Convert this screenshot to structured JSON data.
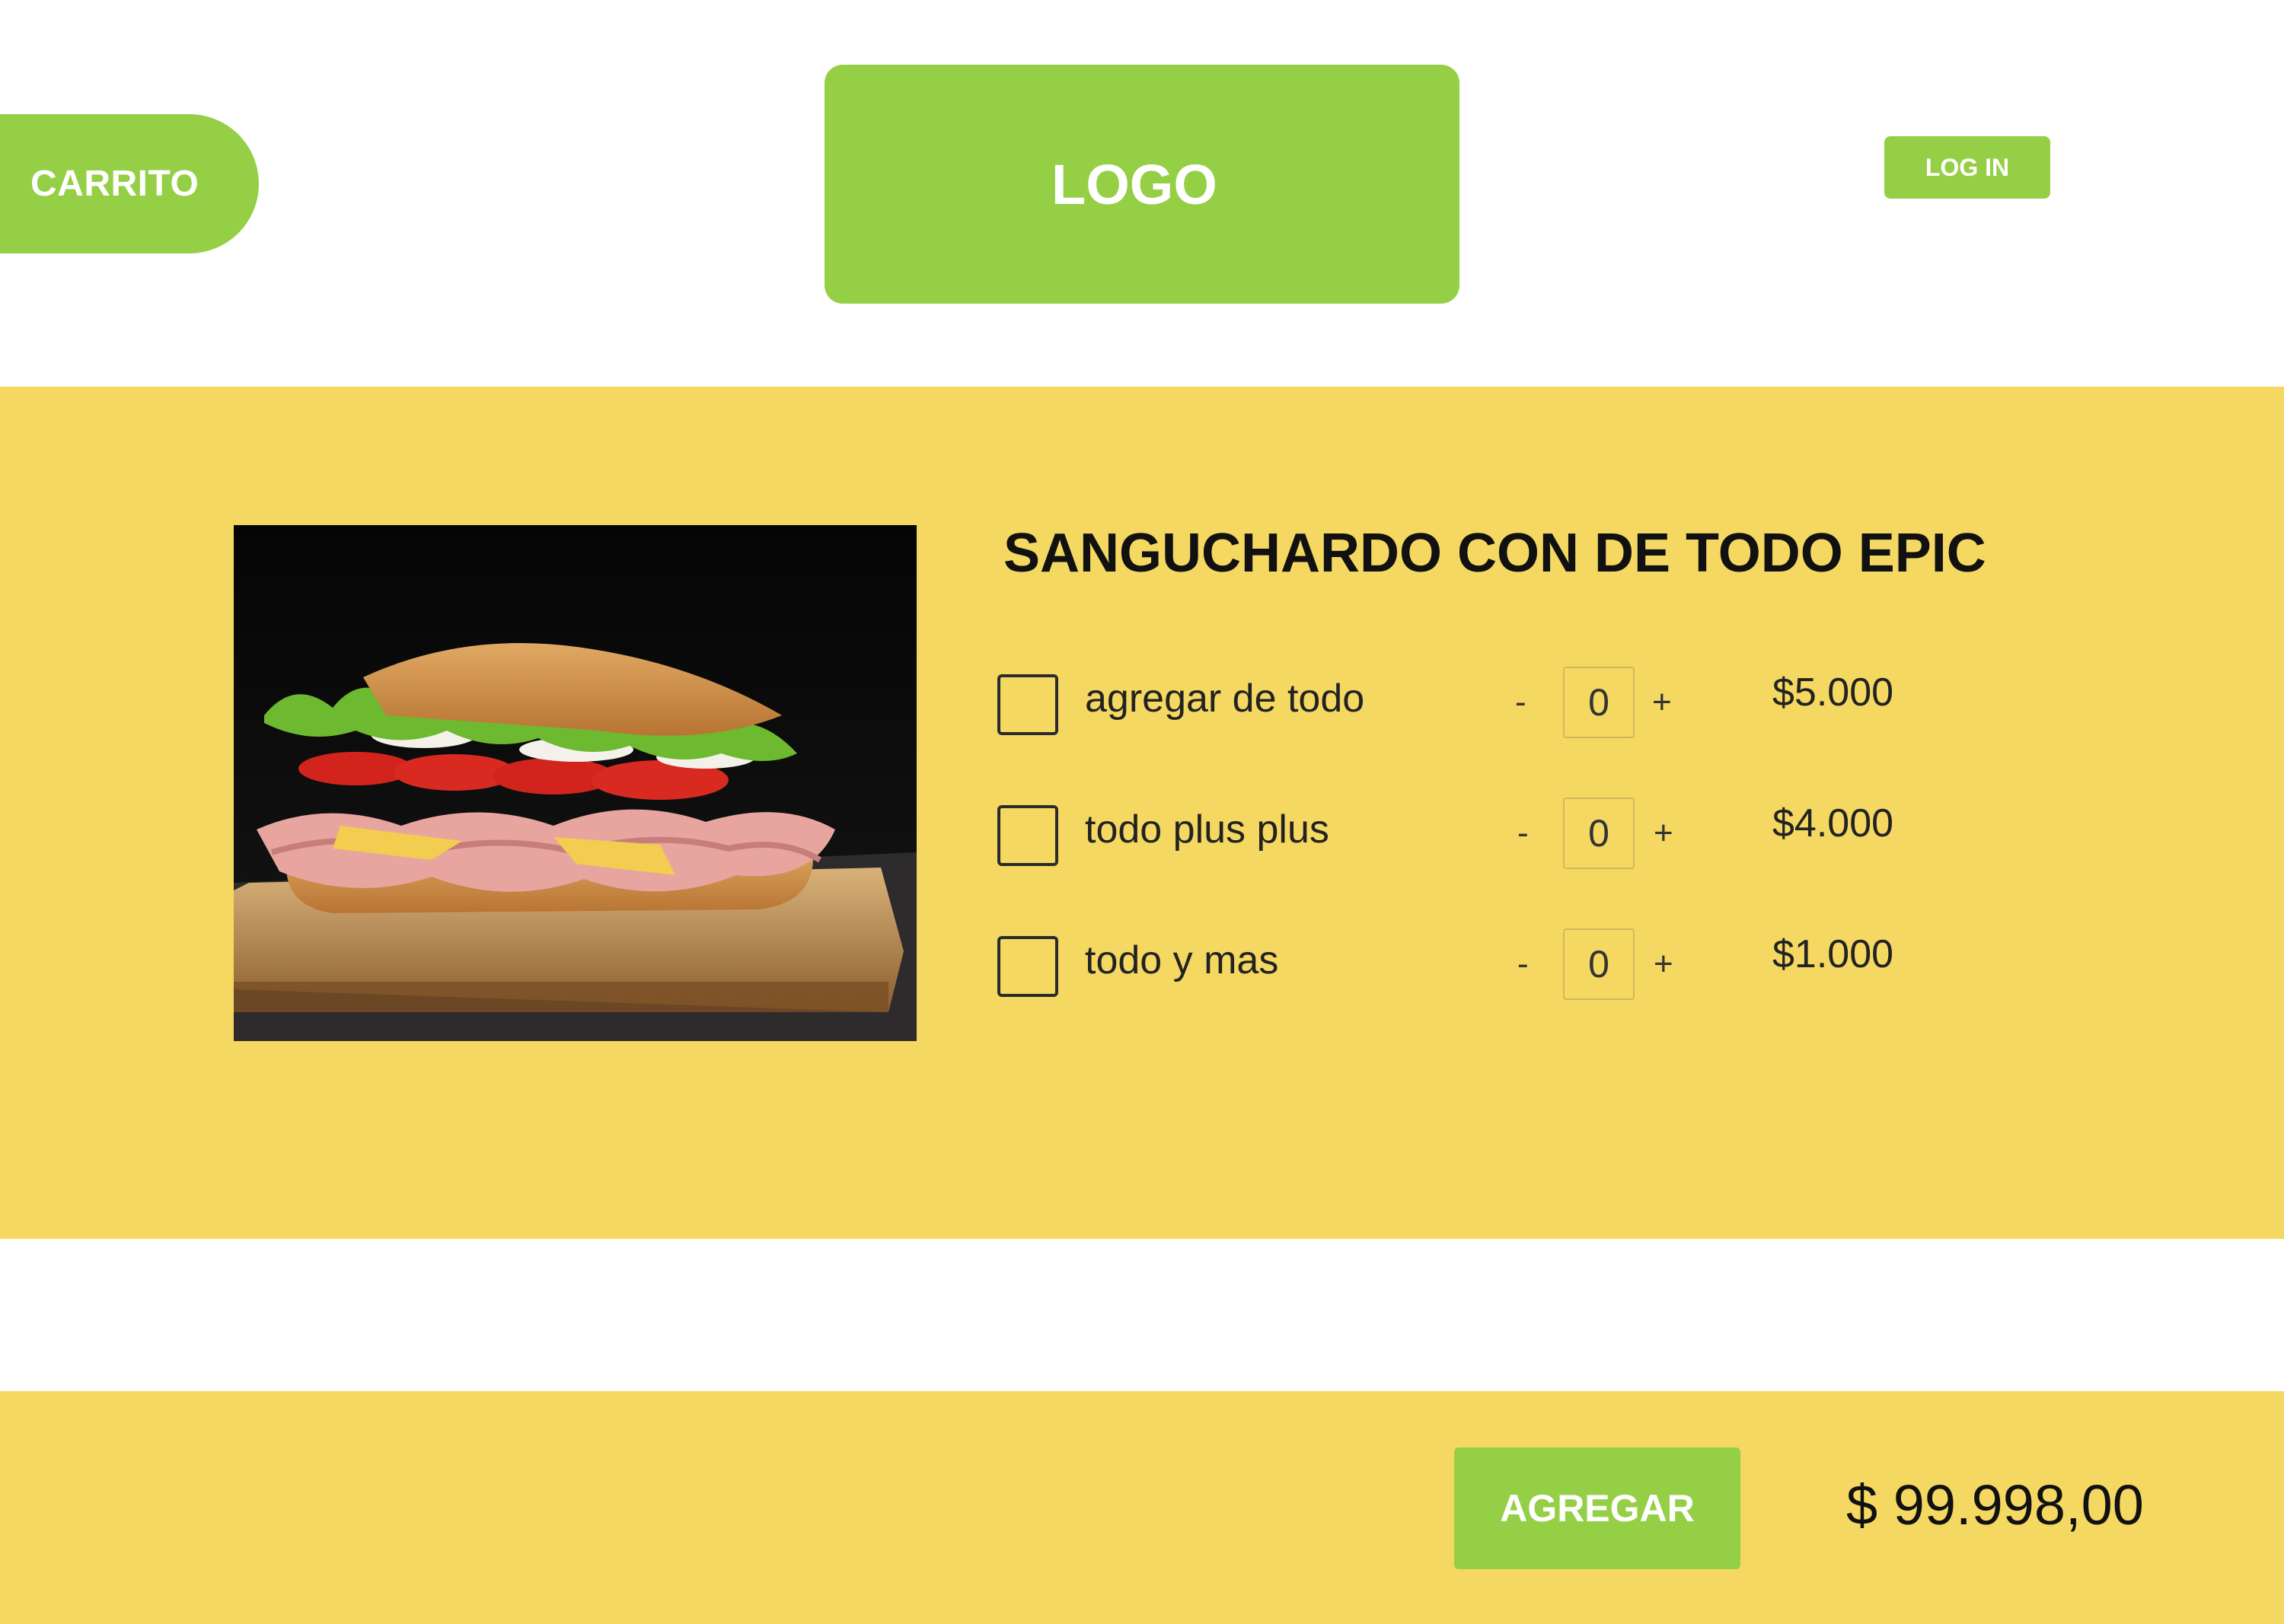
{
  "header": {
    "cart_label": "CARRITO",
    "logo_label": "LOGO",
    "login_label": "LOG IN"
  },
  "product": {
    "title": "SANGUCHARDO CON DE TODO EPIC",
    "image": "sandwich-photo",
    "options": [
      {
        "label": "agregar de todo",
        "quantity": "0",
        "price": "$5.000",
        "checked": false
      },
      {
        "label": "todo plus plus",
        "quantity": "0",
        "price": "$4.000",
        "checked": false
      },
      {
        "label": "todo y mas",
        "quantity": "0",
        "price": "$1.000",
        "checked": false
      }
    ],
    "minus_symbol": "-",
    "plus_symbol": "+"
  },
  "footer": {
    "add_label": "AGREGAR",
    "total": "$ 99.998,00"
  },
  "colors": {
    "green": "#95cf45",
    "yellow": "#f4d862"
  }
}
